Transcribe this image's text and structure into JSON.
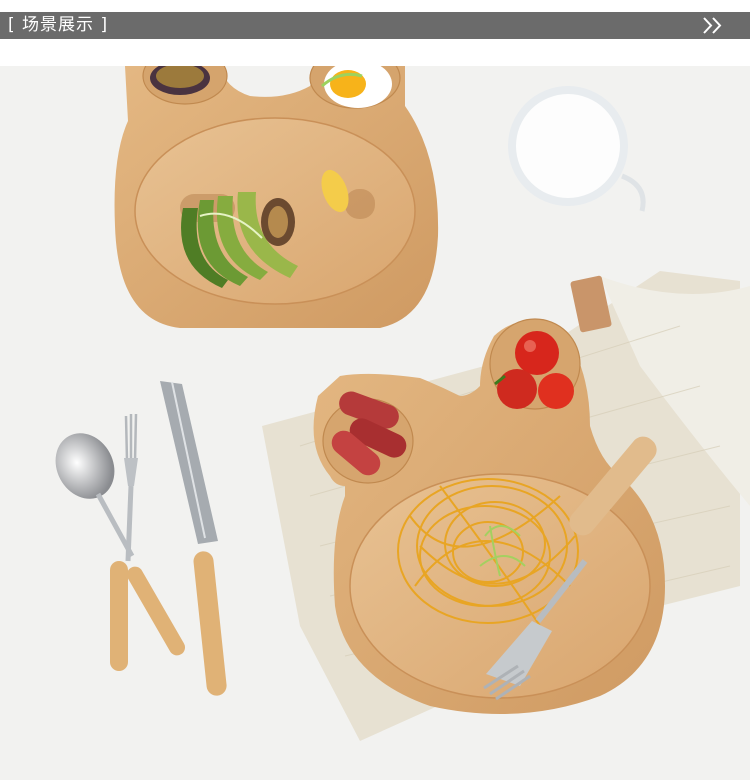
{
  "header": {
    "title": "[ 场景展示 ]",
    "arrow_icon": "double-chevron-right-icon",
    "bar_color": "#6b6b6b"
  },
  "scene": {
    "background_color": "#f2f2f0",
    "wood_color": "#dcab75"
  }
}
